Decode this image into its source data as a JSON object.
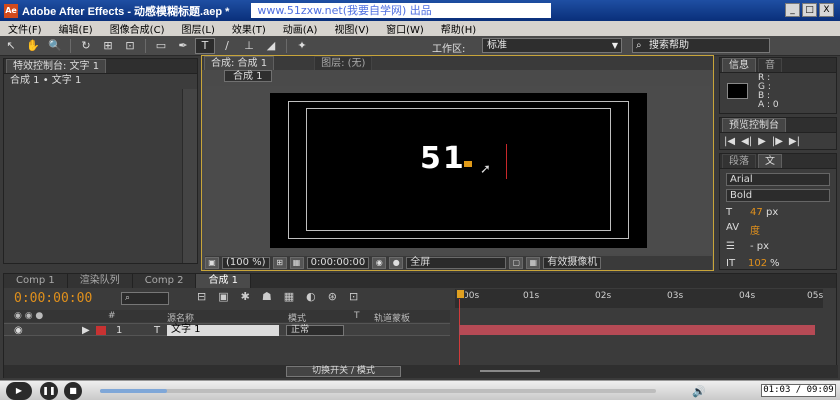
{
  "window": {
    "title": "Adobe After Effects - 动感模糊标题.aep *",
    "banner": "www.51zxw.net(我要自学网) 出品",
    "buttons": [
      "_",
      "□",
      "X"
    ]
  },
  "menu": [
    "文件(F)",
    "编辑(E)",
    "图像合成(C)",
    "图层(L)",
    "效果(T)",
    "动画(A)",
    "视图(V)",
    "窗口(W)",
    "帮助(H)"
  ],
  "toolbar": {
    "workspace_label": "工作区:",
    "workspace_value": "标准",
    "search_help": "搜索帮助"
  },
  "effects_panel": {
    "tab_label": "特效控制台: 文字 1",
    "breadcrumb": "合成 1 • 文字 1"
  },
  "comp_panel": {
    "tab_comp": "合成: 合成 1",
    "tab_layer": "图层: (无)",
    "subtab": "合成 1",
    "canvas_text": "51",
    "zoom": "(100 %)",
    "timecode": "0:00:00:00",
    "resolution": "全屏",
    "camera": "有效摄像机"
  },
  "info_panel": {
    "tab_info": "信息",
    "tab_audio": "音",
    "channels": [
      "R :",
      "G :",
      "B :",
      "A : 0"
    ]
  },
  "preview_panel": {
    "tab": "预览控制台"
  },
  "char_panel": {
    "tab_para": "段落",
    "tab_char": "文",
    "font": "Arial",
    "style": "Bold",
    "size": "47",
    "size_unit": "px",
    "leading_label": "度",
    "indent": "- px",
    "scale": "102",
    "scale_unit": "%"
  },
  "timeline": {
    "tabs": [
      "Comp 1",
      "渲染队列",
      "Comp 2",
      "合成 1"
    ],
    "timecode": "0:00:00:00",
    "ruler_labels": [
      "00s",
      "01s",
      "02s",
      "03s",
      "04s",
      "05s"
    ],
    "header_cols": [
      "#",
      "源名称",
      "模式",
      "T",
      "轨道蒙板"
    ],
    "layer": {
      "index": "1",
      "name": "文字 1",
      "mode": "正常"
    },
    "switches_label": "切换开关 / 模式"
  },
  "player": {
    "time": "01:03 / 09:09",
    "progress": 0.12
  },
  "colors": {
    "accent_orange": "#e0901c",
    "layer_red": "#c83232",
    "title_blue": "#1f4fa3"
  }
}
